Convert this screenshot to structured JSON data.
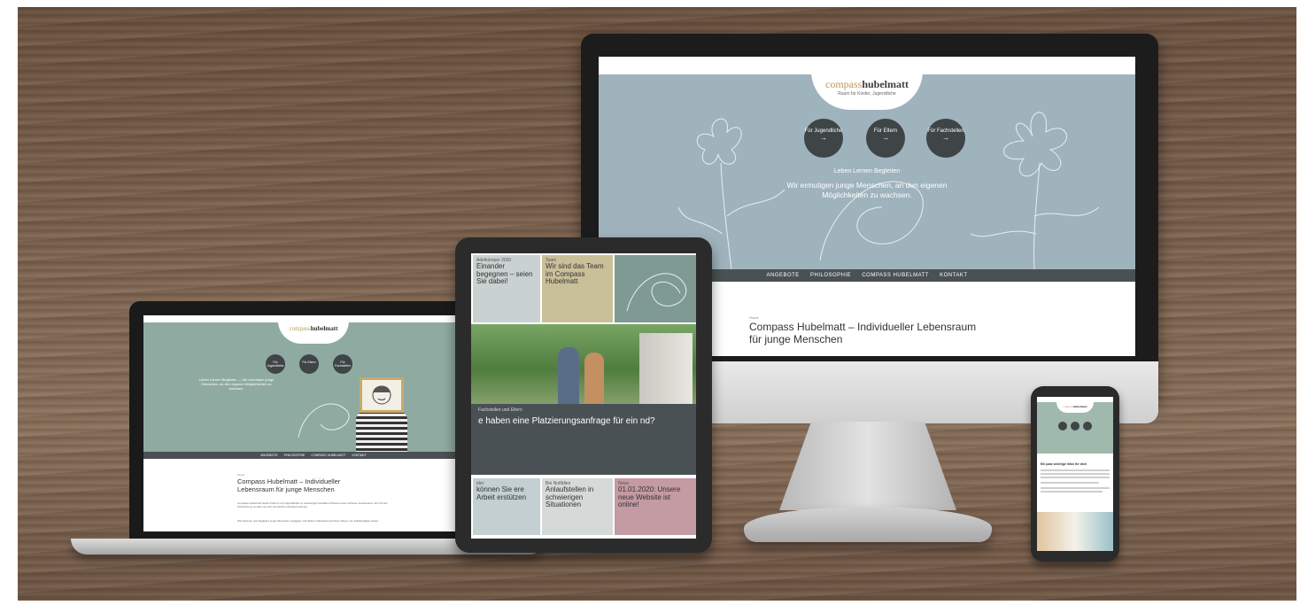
{
  "desktop": {
    "logo_a": "compass",
    "logo_b": "hubelmatt",
    "logo_sub": "Raum für Kinder, Jugendliche",
    "circles": [
      {
        "label": "Für Jugendliche",
        "arrow": "→"
      },
      {
        "label": "Für Eltern",
        "arrow": "→"
      },
      {
        "label": "Für Fachstellen",
        "arrow": "→"
      }
    ],
    "tagline": "Leben Lernen Begleiten",
    "hero_text": "Wir ermutigen junge Menschen, an den eigenen Möglichkeiten zu wachsen.",
    "nav": [
      "ANGEBOTE",
      "PHILOSOPHIE",
      "COMPASS HUBELMATT",
      "KONTAKT"
    ],
    "crumb": "Home",
    "title": "Compass Hubelmatt – Individueller Lebensraum für junge Menschen"
  },
  "laptop": {
    "logo_a": "compass",
    "logo_b": "hubelmatt",
    "circles": [
      "Für Jugendliche",
      "Für Eltern",
      "Für Fachstellen"
    ],
    "hero_text": "Leben Lernen Begleiten — Wir ermutigen junge Menschen, an den eigenen Möglichkeiten zu wachsen.",
    "nav": [
      "ANGEBOTE",
      "PHILOSOPHIE",
      "COMPASS HUBELMATT",
      "KONTAKT"
    ],
    "crumb": "Home",
    "title": "Compass Hubelmatt – Individueller Lebensraum für junge Menschen",
    "para1": "Compass Hubelmatt bietet Kindern und Jugendlichen in schwierigen familiären Phasen einen sicheren Lebensraum. Ein Ort der Orientierung, an dem sie sich persönlich entwickeln können.",
    "para2": "Wir betreuen und begleiten junge Menschen engagiert und fördern individuell auf ihrem Weg in ein selbständiges Leben."
  },
  "tablet": {
    "tile1_kicker": "Adelkümper 2020",
    "tile1_title": "Einander begegnen – seien Sie dabei!",
    "tile2_kicker": "Team",
    "tile2_title": "Wir sind das Team im Compass Hubelmatt",
    "band_kicker": "Fachstellen und Eltern",
    "band_title": "e haben eine Platzierungsanfrage für ein nd?",
    "tile3_kicker": "ider",
    "tile3_title": "können Sie ere Arbeit erstützen",
    "tile4_kicker": "Bei Notfällen",
    "tile4_title": "Anlaufstellen in schwierigen Situationen",
    "tile5_kicker": "News",
    "tile5_title": "01.01.2020: Unsere neue Website ist online!"
  },
  "phone": {
    "logo_a": "compass",
    "logo_b": "hubelmatt",
    "heading": "Ein paar wichtige Infos für dich"
  },
  "colors": {
    "desktop_hero": "#9fb3bd",
    "laptop_hero": "#8faaa1",
    "nav_bar": "#4a5154",
    "logo_gold": "#b99a5a"
  }
}
